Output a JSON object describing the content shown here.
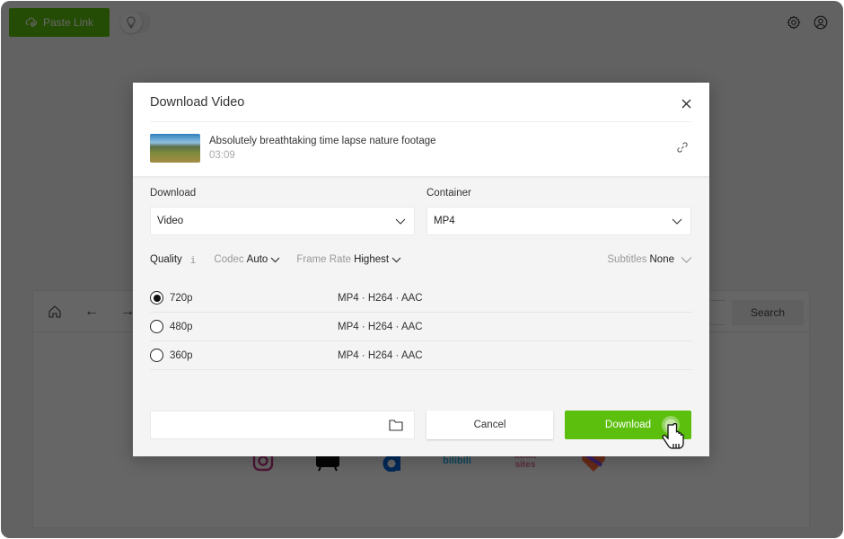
{
  "topbar": {
    "paste_link_label": "Paste Link",
    "paste_link_icon": "cloud-link-icon",
    "toggle_icon": "lightbulb-icon",
    "settings_icon": "gear-icon",
    "account_icon": "user-circle-icon"
  },
  "background_browser": {
    "nav_icons": [
      "home-icon",
      "arrow-left-icon",
      "arrow-right-icon"
    ],
    "search_button_label": "Search",
    "sites": [
      {
        "name": "instagram",
        "color": "#c13584"
      },
      {
        "name": "tv",
        "color": "#111111"
      },
      {
        "name": "dailymotion",
        "color": "#0066dc"
      },
      {
        "name": "bilibili",
        "label": "bilibili",
        "color": "#23aee5"
      },
      {
        "name": "adult-sites",
        "label": "adult sites",
        "color": "#e46fa0"
      },
      {
        "name": "likee",
        "color": "#ff5a4a"
      }
    ]
  },
  "modal": {
    "title": "Download Video",
    "close_icon": "close-icon",
    "video": {
      "title": "Absolutely breathtaking time lapse nature footage",
      "duration": "03:09",
      "link_icon": "link-icon"
    },
    "download_label": "Download",
    "download_value": "Video",
    "container_label": "Container",
    "container_value": "MP4",
    "options": {
      "quality_label": "Quality",
      "quality_info": "i",
      "codec_label": "Codec",
      "codec_value": "Auto",
      "frame_rate_label": "Frame Rate",
      "frame_rate_value": "Highest",
      "subtitles_label": "Subtitles",
      "subtitles_value": "None"
    },
    "qualities": [
      {
        "resolution": "720p",
        "format": "MP4 · H264 · AAC",
        "selected": true
      },
      {
        "resolution": "480p",
        "format": "MP4 · H264 · AAC",
        "selected": false
      },
      {
        "resolution": "360p",
        "format": "MP4 · H264 · AAC",
        "selected": false
      }
    ],
    "save_path_value": "",
    "folder_icon": "folder-icon",
    "cancel_label": "Cancel",
    "download_button_label": "Download"
  },
  "colors": {
    "accent": "#5cbf0e",
    "overlay": "rgba(0,0,0,0.6)"
  }
}
